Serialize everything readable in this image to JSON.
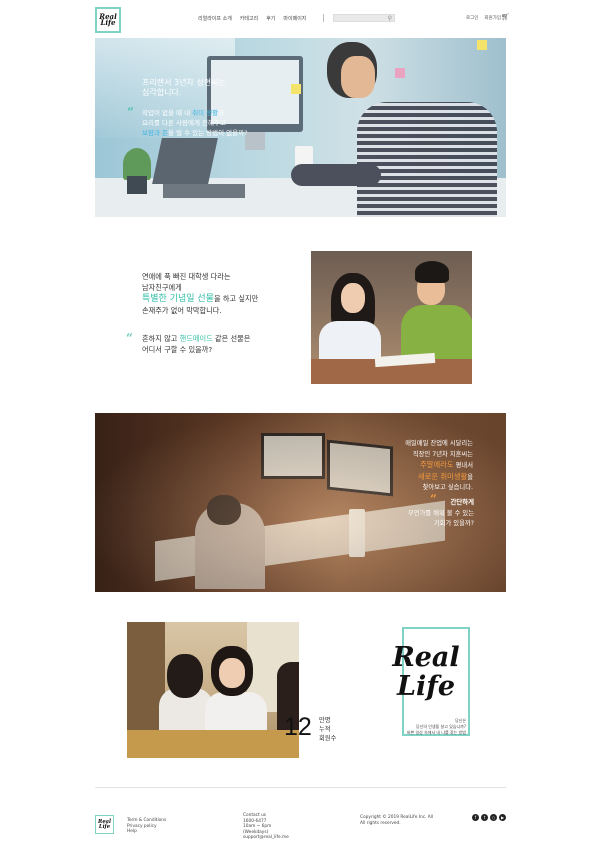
{
  "header": {
    "logo": [
      "Real",
      "Life"
    ],
    "nav": [
      "리얼라이프 소개",
      "카테고리",
      "후기",
      "마이페이지"
    ],
    "util": [
      "로그인",
      "회원가입"
    ]
  },
  "section1": {
    "title": "프리랜서 3년차 성현씨는\n심각합니다.",
    "body_lines": [
      [
        "작업이 없을 때 내 ",
        "취미 생활",
        "과"
      ],
      [
        "요리를 다른 사람에게 전해주고",
        "",
        ""
      ],
      [
        "보람과 돈",
        "을 벌 수 있는 방법이 없을까?",
        ""
      ]
    ]
  },
  "section2": {
    "line1": "연애에 푹 빠진 대학생 다라는",
    "line2": "남자친구에게",
    "big_highlight": "특별한 기념일 선물",
    "big_rest": "을 하고 싶지만",
    "line3": "손재주가 없어 막막합니다.",
    "quote_line1_pre": "흔하지 않고 ",
    "quote_line1_hl": "핸드메이드",
    "quote_line1_post": " 같은 선물은",
    "quote_line2": "어디서 구할 수 있을까?"
  },
  "section3": {
    "line1": "매일매일 잔업에 시달리는",
    "line2": "직장인 7년차 지훈씨는",
    "hl1_pre": "",
    "hl1": "주말에라도",
    "hl1_post": " 평내서",
    "hl2": "새로운 취미생활",
    "hl2_post": "을",
    "line3": "찾아보고 싶습니다.",
    "quote_head": "간단하게",
    "quote_line1": "무언가를 배워 볼 수 있는",
    "quote_line2": "기회가 있을까?"
  },
  "section4": {
    "stat_number": "12",
    "stat_labels": [
      "만명",
      "누적",
      "회원수"
    ],
    "logo": [
      "Real",
      "Life"
    ],
    "logo_caption": [
      "당신은",
      "당신의 인생을 살고 있습니까?",
      "바쁜 일상 속에서 내 나를 찾는 방법"
    ]
  },
  "footer": {
    "logo": [
      "Real",
      "Life"
    ],
    "links": [
      "Term & Conditions",
      "Privacy policy",
      "Help"
    ],
    "contact": [
      "Contact us",
      "1600-6477",
      "10am ~ 6pm",
      "(Weekdays)",
      "support@real_life.me"
    ],
    "copyright": [
      "Copyright © 2019 RealLife Inc. All",
      "All rights reserved."
    ],
    "social_icons": [
      "facebook-icon",
      "twitter-icon",
      "instagram-icon",
      "youtube-icon"
    ]
  },
  "colors": {
    "accent_teal": "#7fd3c4",
    "highlight_blue": "#43b7e4",
    "highlight_teal": "#35bfa8",
    "highlight_orange": "#f29a3e"
  }
}
